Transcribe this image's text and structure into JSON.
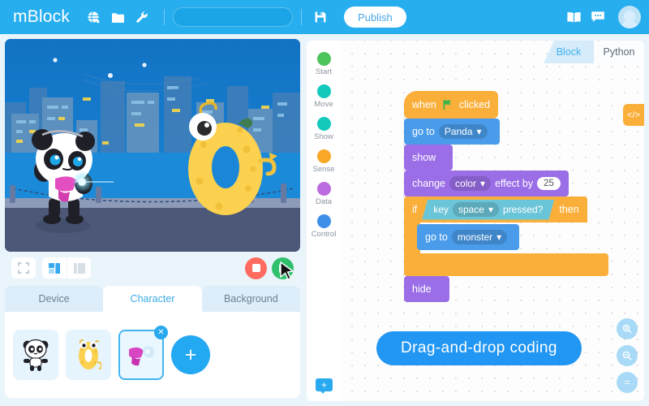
{
  "header": {
    "logo": "mBlock",
    "icons": [
      {
        "name": "globe-icon"
      },
      {
        "name": "folder-icon"
      },
      {
        "name": "wrench-icon"
      }
    ],
    "search": {
      "value": "",
      "placeholder": ""
    },
    "save_icon": "save-icon",
    "publish_label": "Publish",
    "right_icons": [
      {
        "name": "book-icon"
      },
      {
        "name": "chat-icon"
      }
    ],
    "avatar": "user-avatar"
  },
  "stage": {
    "controls": {
      "fullscreen": "fullscreen-icon",
      "layout_small": "layout-small-icon",
      "layout_large": "layout-large-icon",
      "stop": "stop-button",
      "play": "green-flag-button"
    }
  },
  "left_tabs": [
    {
      "label": "Device",
      "active": false
    },
    {
      "label": "Character",
      "active": true
    },
    {
      "label": "Background",
      "active": false
    }
  ],
  "sprites": [
    {
      "name": "panda-sprite",
      "selected": false
    },
    {
      "name": "monster-sprite",
      "selected": false
    },
    {
      "name": "raygun-sprite",
      "selected": true
    }
  ],
  "add_sprite_label": "+",
  "palette": {
    "categories": [
      {
        "label": "Start",
        "color": "#4cc45d"
      },
      {
        "label": "Move",
        "color": "#12c9bb"
      },
      {
        "label": "Show",
        "color": "#12c9bb"
      },
      {
        "label": "Sense",
        "color": "#f9a826"
      },
      {
        "label": "Data",
        "color": "#bb6be0"
      },
      {
        "label": "Control",
        "color": "#3d8fe8"
      }
    ],
    "add_label": "+"
  },
  "canvas": {
    "tabs": [
      {
        "label": "Block",
        "active": true
      },
      {
        "label": "Python",
        "active": false
      }
    ],
    "code_tab_label": "</>",
    "banner_text": "Drag-and-drop coding",
    "zoom_buttons": [
      {
        "name": "zoom-in-button",
        "glyph": "⌕"
      },
      {
        "name": "zoom-out-button",
        "glyph": "⌕"
      },
      {
        "name": "zoom-reset-button",
        "glyph": "="
      }
    ]
  },
  "script_blocks": [
    {
      "id": "when-flag-clicked",
      "category": "Start",
      "color": "#fbaf3b",
      "text_before": "when",
      "icon": "green-flag-icon",
      "text_after": "clicked"
    },
    {
      "id": "go-to-panda",
      "category": "Move",
      "color": "#4a9ceb",
      "text_before": "go to",
      "dropdown": "Panda",
      "text_after": ""
    },
    {
      "id": "show",
      "category": "Show",
      "color": "#9b6ee8",
      "text_before": "show"
    },
    {
      "id": "change-color-effect",
      "category": "Show",
      "color": "#9b6ee8",
      "text_before": "change",
      "dropdown": "color",
      "text_mid": "effect by",
      "value": "25"
    },
    {
      "id": "if-key-pressed-then",
      "category": "Control",
      "color": "#fbaf3b",
      "text_before": "if",
      "cond_before": "key",
      "cond_dropdown": "space",
      "cond_after": "pressed?",
      "text_after": "then"
    },
    {
      "id": "go-to-monster",
      "category": "Move",
      "color": "#4a9ceb",
      "text_before": "go to",
      "dropdown": "monster",
      "text_after": ""
    },
    {
      "id": "hide",
      "category": "Show",
      "color": "#9b6ee8",
      "text_before": "hide"
    }
  ]
}
